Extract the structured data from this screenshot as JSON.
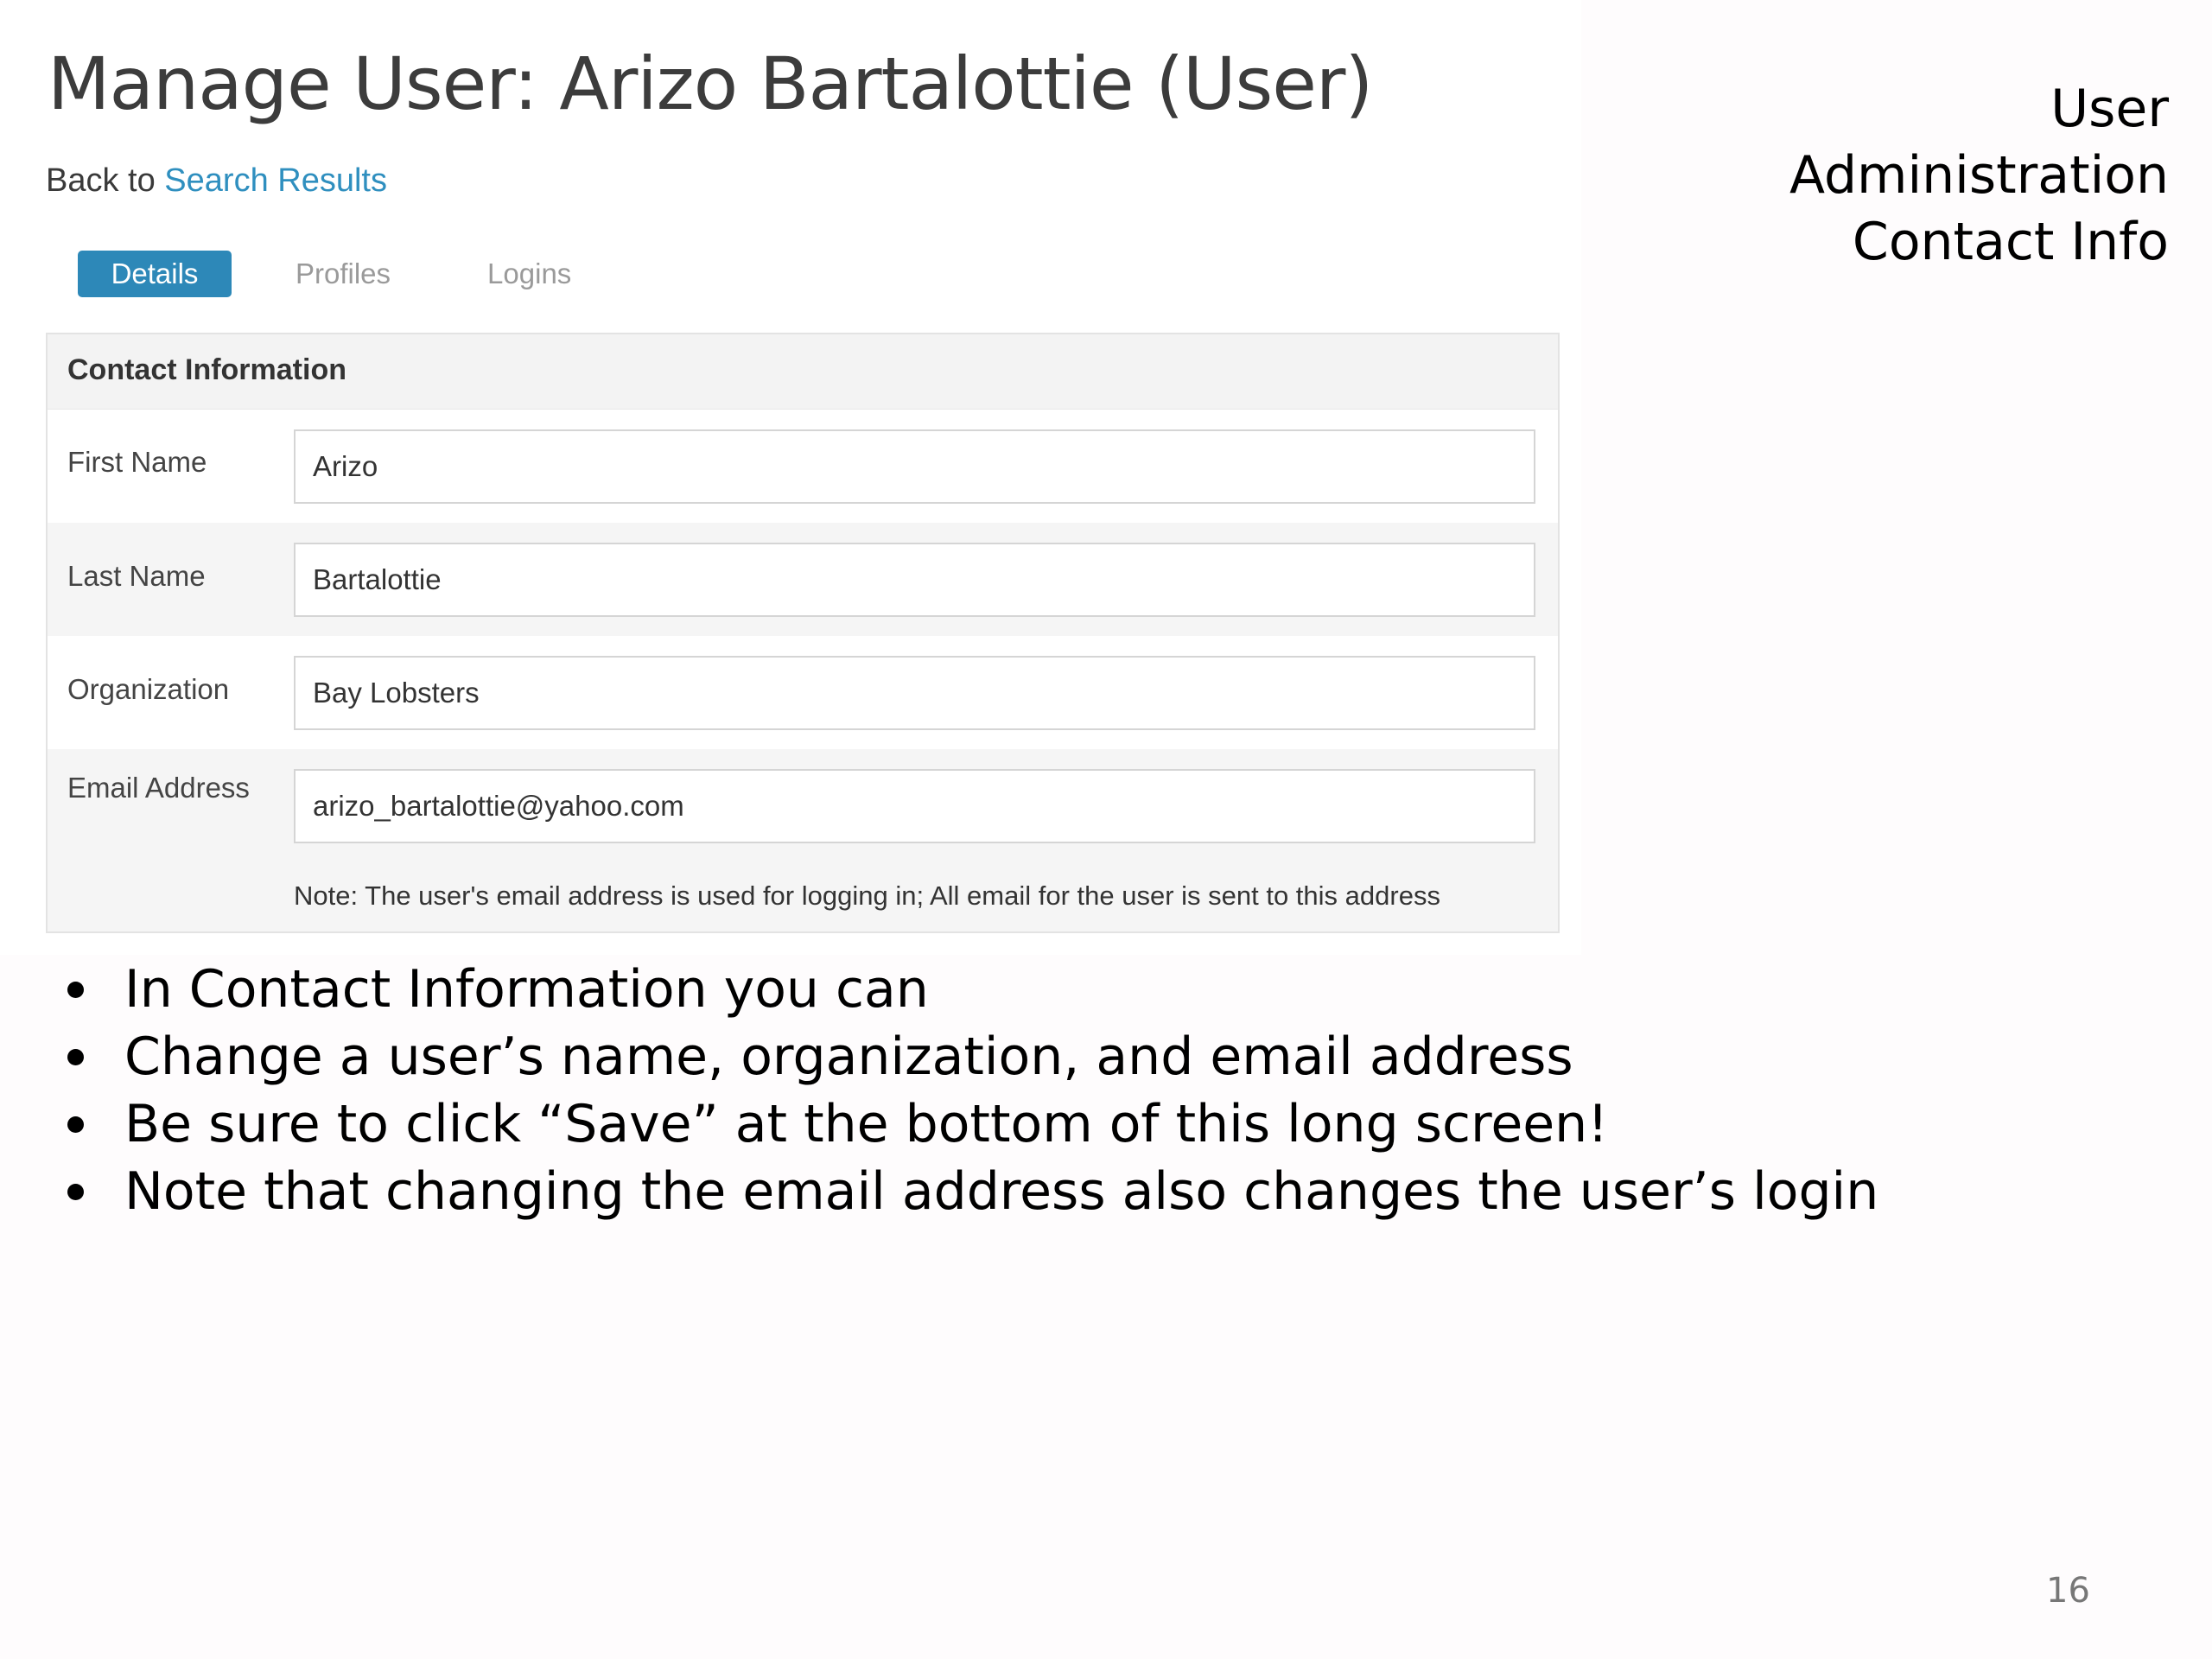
{
  "screenshot": {
    "title": "Manage User: Arizo Bartalottie (User)",
    "back_prefix": "Back to ",
    "back_link": "Search Results",
    "tabs": [
      {
        "label": "Details",
        "active": true
      },
      {
        "label": "Profiles",
        "active": false
      },
      {
        "label": "Logins",
        "active": false
      }
    ],
    "panel": {
      "title": "Contact Information",
      "fields": [
        {
          "label": "First Name",
          "value": "Arizo"
        },
        {
          "label": "Last Name",
          "value": "Bartalottie"
        },
        {
          "label": "Organization",
          "value": "Bay Lobsters"
        },
        {
          "label": "Email Address",
          "value": "arizo_bartalottie@yahoo.com"
        }
      ],
      "note": "Note: The user's email address is used for logging in; All email for the user is sent to this address"
    }
  },
  "slide": {
    "heading_lines": [
      "User",
      "Administration",
      "Contact Info"
    ],
    "bullets": [
      "In Contact Information you can",
      "Change a user’s name, organization, and email address",
      "Be sure to click “Save” at the bottom of this long screen!",
      "Note that changing the email address also changes the user’s login"
    ],
    "page_number": "16"
  },
  "colors": {
    "accent": "#2d88b8",
    "link": "#2f8fbf"
  }
}
